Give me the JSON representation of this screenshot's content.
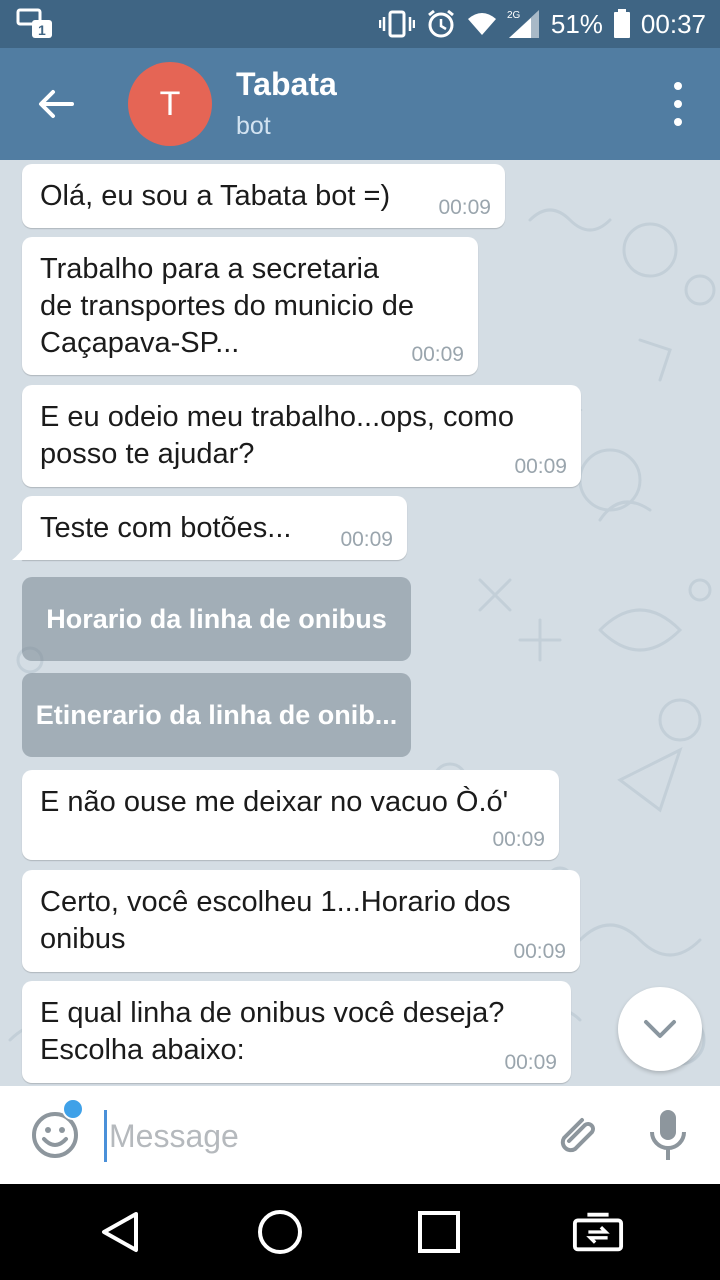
{
  "status_bar": {
    "battery": "51%",
    "time": "00:37",
    "network": "2G",
    "icons": [
      "app-notification-icon",
      "vibrate-icon",
      "alarm-icon",
      "wifi-icon",
      "signal-icon",
      "battery-icon"
    ]
  },
  "header": {
    "avatar_letter": "T",
    "title": "Tabata",
    "subtitle": "bot",
    "avatar_color": "#e56555",
    "bar_color": "#517da2"
  },
  "messages": [
    {
      "text": "Olá, eu sou a Tabata bot =)",
      "time": "00:09"
    },
    {
      "text": "Trabalho para a secretaria de transportes do municio de Caçapava-SP...",
      "time": "00:09"
    },
    {
      "text": "E eu odeio meu trabalho...ops, como posso te ajudar?",
      "time": "00:09"
    },
    {
      "text": "Teste com botões...",
      "time": "00:09"
    }
  ],
  "inline_buttons": [
    {
      "label": "Horario da linha de onibus"
    },
    {
      "label": "Etinerario da linha de onib..."
    }
  ],
  "messages_after": [
    {
      "text": "E não ouse me deixar no vacuo Ò.ó'",
      "time": "00:09"
    },
    {
      "text": "Certo, você escolheu 1...Horario dos onibus",
      "time": "00:09"
    },
    {
      "text": "E qual linha de onibus você deseja? Escolha abaixo:",
      "time": "00:09"
    }
  ],
  "input": {
    "placeholder": "Message",
    "value": ""
  }
}
